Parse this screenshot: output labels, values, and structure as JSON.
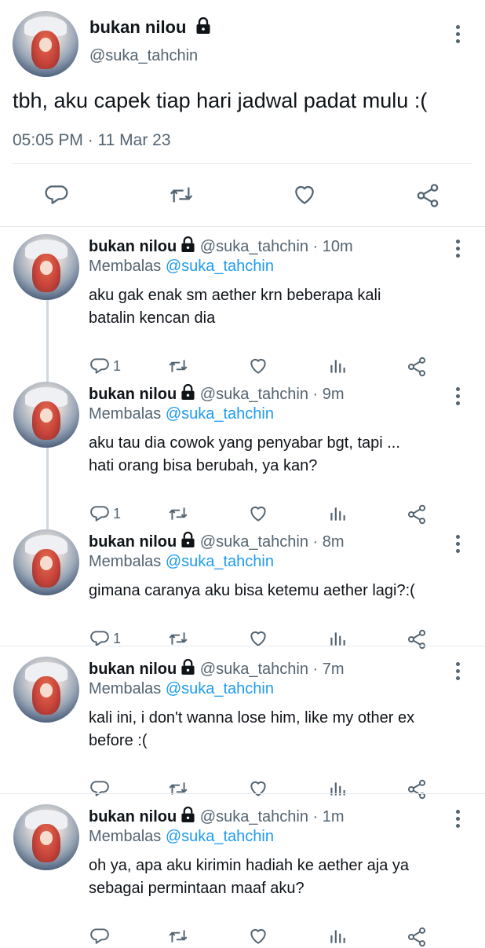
{
  "main_tweet": {
    "name": "bukan nilou",
    "handle": "@suka_tahchin",
    "text": "tbh, aku capek tiap hari jadwal padat mulu :(",
    "timestamp": "05:05 PM · 11 Mar 23"
  },
  "replies": [
    {
      "name": "bukan nilou",
      "handle": "@suka_tahchin",
      "time": "· 10m",
      "reply_prefix": "Membalas",
      "reply_to": "@suka_tahchin",
      "text_lines": [
        "aku gak enak sm aether krn beberapa kali",
        "batalin kencan dia"
      ],
      "reply_count": "1"
    },
    {
      "name": "bukan nilou",
      "handle": "@suka_tahchin",
      "time": "· 9m",
      "reply_prefix": "Membalas",
      "reply_to": "@suka_tahchin",
      "text_lines": [
        "aku tau dia cowok yang penyabar bgt, tapi ...",
        "hati orang bisa berubah, ya kan?"
      ],
      "reply_count": "1"
    },
    {
      "name": "bukan nilou",
      "handle": "@suka_tahchin",
      "time": "· 8m",
      "reply_prefix": "Membalas",
      "reply_to": "@suka_tahchin",
      "text_lines": [
        "gimana caranya aku bisa ketemu aether lagi?:("
      ],
      "reply_count": "1"
    },
    {
      "name": "bukan nilou",
      "handle": "@suka_tahchin",
      "time": "· 7m",
      "reply_prefix": "Membalas",
      "reply_to": "@suka_tahchin",
      "text_lines": [
        "kali ini, i don't wanna lose him, like my other ex",
        "before :("
      ],
      "reply_count": ""
    },
    {
      "name": "bukan nilou",
      "handle": "@suka_tahchin",
      "time": "· 1m",
      "reply_prefix": "Membalas",
      "reply_to": "@suka_tahchin",
      "text_lines": [
        "oh ya, apa aku kirimin hadiah ke aether aja ya",
        "sebagai permintaan maaf aku?"
      ],
      "reply_count": ""
    }
  ],
  "icons": {
    "reply": "reply-icon",
    "retweet": "retweet-icon",
    "like": "heart-icon",
    "analytics": "analytics-icon",
    "share": "share-icon",
    "more": "more-icon",
    "lock": "lock-icon"
  },
  "colors": {
    "link": "#1d9bf0",
    "muted": "#536471",
    "text": "#0f1419"
  }
}
